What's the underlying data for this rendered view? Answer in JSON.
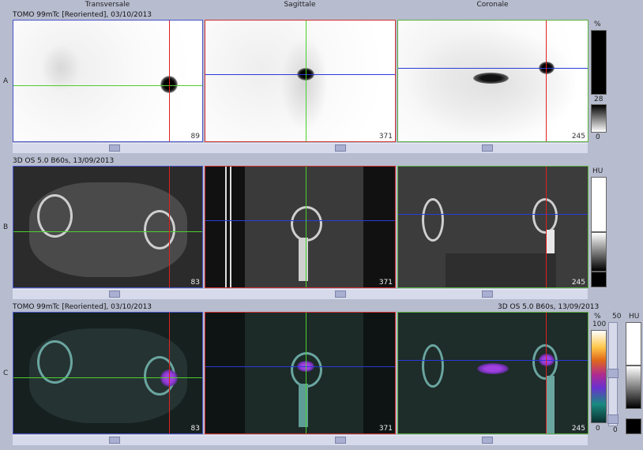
{
  "headers": {
    "transversale": "Transversale",
    "sagittale": "Sagittale",
    "coronale": "Coronale"
  },
  "rows": {
    "a": "A",
    "b": "B",
    "c": "C"
  },
  "titles": {
    "spect": "TOMO 99mTc [Reoriented], 03/10/2013",
    "ct": "3D OS 5.0 B60s, 13/09/2013",
    "fused_left": "TOMO 99mTc [Reoriented], 03/10/2013",
    "fused_right": "3D OS 5.0 B60s, 13/09/2013"
  },
  "slices": {
    "a": [
      "89",
      "371",
      "245"
    ],
    "b": [
      "83",
      "371",
      "245"
    ],
    "c": [
      "83",
      "371",
      "245"
    ]
  },
  "scales": {
    "spect_unit": "%",
    "spect_top": "28",
    "spect_bottom": "0",
    "ct_unit": "HU",
    "fused_unit": "%",
    "fused_top": "100",
    "fused_bottom": "0",
    "fused_mid": "50",
    "fused_mid_bottom": "0",
    "fused_hu_unit": "HU"
  },
  "colors": {
    "transversal_border": "#4a55c8",
    "sagittal_border": "#d03030",
    "coronal_border": "#5ab040",
    "crosshair_green": "#4ccf2f",
    "crosshair_red": "#e02020",
    "crosshair_blue": "#2a3ad8"
  }
}
